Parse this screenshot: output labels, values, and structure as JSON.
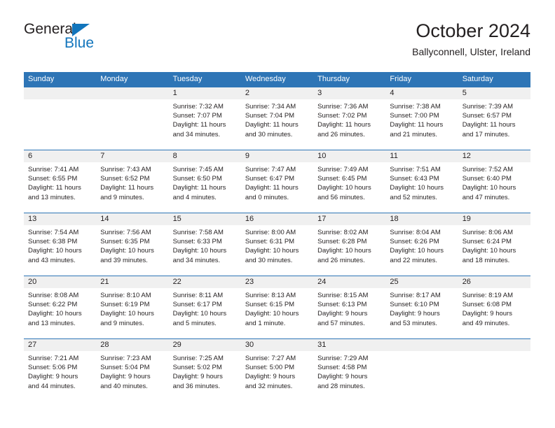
{
  "logo": {
    "word_one": "General",
    "word_two": "Blue",
    "triangle_color": "#1275bc",
    "text_color": "#231f20"
  },
  "header": {
    "title": "October 2024",
    "subtitle": "Ballyconnell, Ulster, Ireland"
  },
  "theme": {
    "header_blue": "#2e75b6",
    "daynum_band": "#f0f0f0",
    "text": "#231f20"
  },
  "weekdays": [
    "Sunday",
    "Monday",
    "Tuesday",
    "Wednesday",
    "Thursday",
    "Friday",
    "Saturday"
  ],
  "weeks": [
    {
      "daynums": [
        "",
        "",
        "1",
        "2",
        "3",
        "4",
        "5"
      ],
      "cells": [
        {
          "empty": true,
          "sunrise": "",
          "sunset": "",
          "daylight_1": "",
          "daylight_2": ""
        },
        {
          "empty": true,
          "sunrise": "",
          "sunset": "",
          "daylight_1": "",
          "daylight_2": ""
        },
        {
          "empty": false,
          "sunrise": "Sunrise: 7:32 AM",
          "sunset": "Sunset: 7:07 PM",
          "daylight_1": "Daylight: 11 hours",
          "daylight_2": "and 34 minutes."
        },
        {
          "empty": false,
          "sunrise": "Sunrise: 7:34 AM",
          "sunset": "Sunset: 7:04 PM",
          "daylight_1": "Daylight: 11 hours",
          "daylight_2": "and 30 minutes."
        },
        {
          "empty": false,
          "sunrise": "Sunrise: 7:36 AM",
          "sunset": "Sunset: 7:02 PM",
          "daylight_1": "Daylight: 11 hours",
          "daylight_2": "and 26 minutes."
        },
        {
          "empty": false,
          "sunrise": "Sunrise: 7:38 AM",
          "sunset": "Sunset: 7:00 PM",
          "daylight_1": "Daylight: 11 hours",
          "daylight_2": "and 21 minutes."
        },
        {
          "empty": false,
          "sunrise": "Sunrise: 7:39 AM",
          "sunset": "Sunset: 6:57 PM",
          "daylight_1": "Daylight: 11 hours",
          "daylight_2": "and 17 minutes."
        }
      ]
    },
    {
      "daynums": [
        "6",
        "7",
        "8",
        "9",
        "10",
        "11",
        "12"
      ],
      "cells": [
        {
          "empty": false,
          "sunrise": "Sunrise: 7:41 AM",
          "sunset": "Sunset: 6:55 PM",
          "daylight_1": "Daylight: 11 hours",
          "daylight_2": "and 13 minutes."
        },
        {
          "empty": false,
          "sunrise": "Sunrise: 7:43 AM",
          "sunset": "Sunset: 6:52 PM",
          "daylight_1": "Daylight: 11 hours",
          "daylight_2": "and 9 minutes."
        },
        {
          "empty": false,
          "sunrise": "Sunrise: 7:45 AM",
          "sunset": "Sunset: 6:50 PM",
          "daylight_1": "Daylight: 11 hours",
          "daylight_2": "and 4 minutes."
        },
        {
          "empty": false,
          "sunrise": "Sunrise: 7:47 AM",
          "sunset": "Sunset: 6:47 PM",
          "daylight_1": "Daylight: 11 hours",
          "daylight_2": "and 0 minutes."
        },
        {
          "empty": false,
          "sunrise": "Sunrise: 7:49 AM",
          "sunset": "Sunset: 6:45 PM",
          "daylight_1": "Daylight: 10 hours",
          "daylight_2": "and 56 minutes."
        },
        {
          "empty": false,
          "sunrise": "Sunrise: 7:51 AM",
          "sunset": "Sunset: 6:43 PM",
          "daylight_1": "Daylight: 10 hours",
          "daylight_2": "and 52 minutes."
        },
        {
          "empty": false,
          "sunrise": "Sunrise: 7:52 AM",
          "sunset": "Sunset: 6:40 PM",
          "daylight_1": "Daylight: 10 hours",
          "daylight_2": "and 47 minutes."
        }
      ]
    },
    {
      "daynums": [
        "13",
        "14",
        "15",
        "16",
        "17",
        "18",
        "19"
      ],
      "cells": [
        {
          "empty": false,
          "sunrise": "Sunrise: 7:54 AM",
          "sunset": "Sunset: 6:38 PM",
          "daylight_1": "Daylight: 10 hours",
          "daylight_2": "and 43 minutes."
        },
        {
          "empty": false,
          "sunrise": "Sunrise: 7:56 AM",
          "sunset": "Sunset: 6:35 PM",
          "daylight_1": "Daylight: 10 hours",
          "daylight_2": "and 39 minutes."
        },
        {
          "empty": false,
          "sunrise": "Sunrise: 7:58 AM",
          "sunset": "Sunset: 6:33 PM",
          "daylight_1": "Daylight: 10 hours",
          "daylight_2": "and 34 minutes."
        },
        {
          "empty": false,
          "sunrise": "Sunrise: 8:00 AM",
          "sunset": "Sunset: 6:31 PM",
          "daylight_1": "Daylight: 10 hours",
          "daylight_2": "and 30 minutes."
        },
        {
          "empty": false,
          "sunrise": "Sunrise: 8:02 AM",
          "sunset": "Sunset: 6:28 PM",
          "daylight_1": "Daylight: 10 hours",
          "daylight_2": "and 26 minutes."
        },
        {
          "empty": false,
          "sunrise": "Sunrise: 8:04 AM",
          "sunset": "Sunset: 6:26 PM",
          "daylight_1": "Daylight: 10 hours",
          "daylight_2": "and 22 minutes."
        },
        {
          "empty": false,
          "sunrise": "Sunrise: 8:06 AM",
          "sunset": "Sunset: 6:24 PM",
          "daylight_1": "Daylight: 10 hours",
          "daylight_2": "and 18 minutes."
        }
      ]
    },
    {
      "daynums": [
        "20",
        "21",
        "22",
        "23",
        "24",
        "25",
        "26"
      ],
      "cells": [
        {
          "empty": false,
          "sunrise": "Sunrise: 8:08 AM",
          "sunset": "Sunset: 6:22 PM",
          "daylight_1": "Daylight: 10 hours",
          "daylight_2": "and 13 minutes."
        },
        {
          "empty": false,
          "sunrise": "Sunrise: 8:10 AM",
          "sunset": "Sunset: 6:19 PM",
          "daylight_1": "Daylight: 10 hours",
          "daylight_2": "and 9 minutes."
        },
        {
          "empty": false,
          "sunrise": "Sunrise: 8:11 AM",
          "sunset": "Sunset: 6:17 PM",
          "daylight_1": "Daylight: 10 hours",
          "daylight_2": "and 5 minutes."
        },
        {
          "empty": false,
          "sunrise": "Sunrise: 8:13 AM",
          "sunset": "Sunset: 6:15 PM",
          "daylight_1": "Daylight: 10 hours",
          "daylight_2": "and 1 minute."
        },
        {
          "empty": false,
          "sunrise": "Sunrise: 8:15 AM",
          "sunset": "Sunset: 6:13 PM",
          "daylight_1": "Daylight: 9 hours",
          "daylight_2": "and 57 minutes."
        },
        {
          "empty": false,
          "sunrise": "Sunrise: 8:17 AM",
          "sunset": "Sunset: 6:10 PM",
          "daylight_1": "Daylight: 9 hours",
          "daylight_2": "and 53 minutes."
        },
        {
          "empty": false,
          "sunrise": "Sunrise: 8:19 AM",
          "sunset": "Sunset: 6:08 PM",
          "daylight_1": "Daylight: 9 hours",
          "daylight_2": "and 49 minutes."
        }
      ]
    },
    {
      "daynums": [
        "27",
        "28",
        "29",
        "30",
        "31",
        "",
        ""
      ],
      "cells": [
        {
          "empty": false,
          "sunrise": "Sunrise: 7:21 AM",
          "sunset": "Sunset: 5:06 PM",
          "daylight_1": "Daylight: 9 hours",
          "daylight_2": "and 44 minutes."
        },
        {
          "empty": false,
          "sunrise": "Sunrise: 7:23 AM",
          "sunset": "Sunset: 5:04 PM",
          "daylight_1": "Daylight: 9 hours",
          "daylight_2": "and 40 minutes."
        },
        {
          "empty": false,
          "sunrise": "Sunrise: 7:25 AM",
          "sunset": "Sunset: 5:02 PM",
          "daylight_1": "Daylight: 9 hours",
          "daylight_2": "and 36 minutes."
        },
        {
          "empty": false,
          "sunrise": "Sunrise: 7:27 AM",
          "sunset": "Sunset: 5:00 PM",
          "daylight_1": "Daylight: 9 hours",
          "daylight_2": "and 32 minutes."
        },
        {
          "empty": false,
          "sunrise": "Sunrise: 7:29 AM",
          "sunset": "Sunset: 4:58 PM",
          "daylight_1": "Daylight: 9 hours",
          "daylight_2": "and 28 minutes."
        },
        {
          "empty": true,
          "sunrise": "",
          "sunset": "",
          "daylight_1": "",
          "daylight_2": ""
        },
        {
          "empty": true,
          "sunrise": "",
          "sunset": "",
          "daylight_1": "",
          "daylight_2": ""
        }
      ]
    }
  ]
}
